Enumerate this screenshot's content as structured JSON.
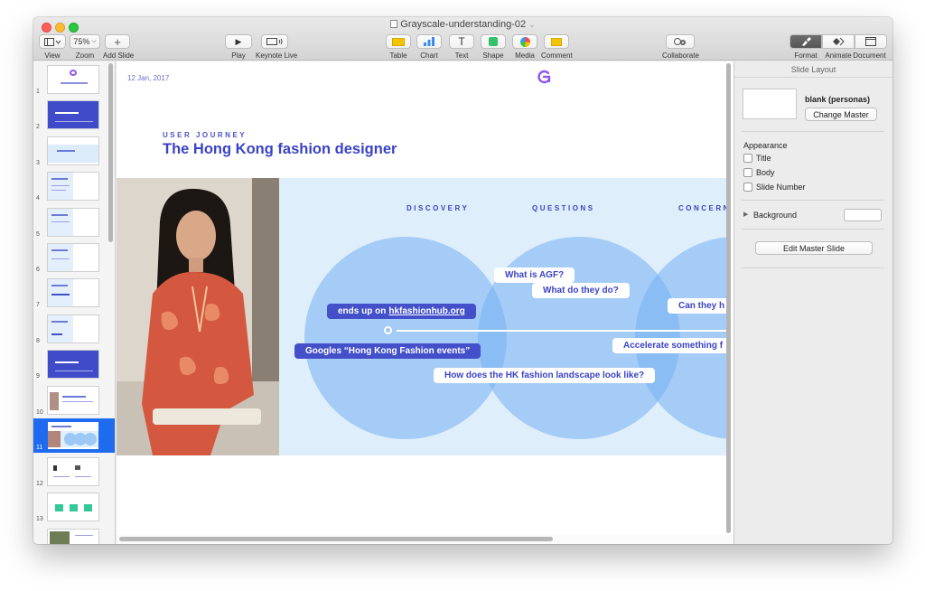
{
  "window": {
    "title": "Grayscale-understanding-02",
    "title_chevron": "⌄"
  },
  "toolbar": {
    "view_label": "View",
    "zoom_value": "75%",
    "zoom_label": "Zoom",
    "add_slide_label": "Add Slide",
    "play_label": "Play",
    "keynote_live_label": "Keynote Live",
    "table_label": "Table",
    "chart_label": "Chart",
    "text_label": "Text",
    "text_glyph": "T",
    "shape_label": "Shape",
    "media_label": "Media",
    "comment_label": "Comment",
    "collaborate_label": "Collaborate",
    "format_label": "Format",
    "animate_label": "Animate",
    "document_label": "Document"
  },
  "navigator": {
    "selected": 11,
    "slides": [
      {
        "number": "1"
      },
      {
        "number": "2"
      },
      {
        "number": "3"
      },
      {
        "number": "4"
      },
      {
        "number": "5"
      },
      {
        "number": "6"
      },
      {
        "number": "7"
      },
      {
        "number": "8"
      },
      {
        "number": "9"
      },
      {
        "number": "10"
      },
      {
        "number": "11"
      },
      {
        "number": "12"
      },
      {
        "number": "13"
      }
    ]
  },
  "slide": {
    "date": "12 Jan, 2017",
    "eyebrow": "USER JOURNEY",
    "heading": "The Hong Kong fashion designer",
    "columns": [
      "DISCOVERY",
      "QUESTIONS",
      "CONCERN"
    ],
    "bubbles": {
      "what_is_agf": "What is AGF?",
      "what_do_they_do": "What do they do?",
      "ends_up_on_prefix": "ends up on",
      "ends_up_on_link": "hkfashionhub.org",
      "can_they": "Can they h",
      "googles": "Googles “Hong Kong Fashion events”",
      "accelerate": "Accelerate something f",
      "landscape": "How does the HK fashion landscape look like?"
    },
    "colors": {
      "accent": "#3b43c4",
      "band": "#dfeefb",
      "circle": "#75b0f2",
      "pill_dark": "#4350c9"
    }
  },
  "inspector": {
    "header": "Slide Layout",
    "master_name": "blank (personas)",
    "change_master": "Change Master",
    "appearance": "Appearance",
    "title_option": "Title",
    "body_option": "Body",
    "slide_number_option": "Slide Number",
    "background": "Background",
    "edit_master": "Edit Master Slide"
  }
}
